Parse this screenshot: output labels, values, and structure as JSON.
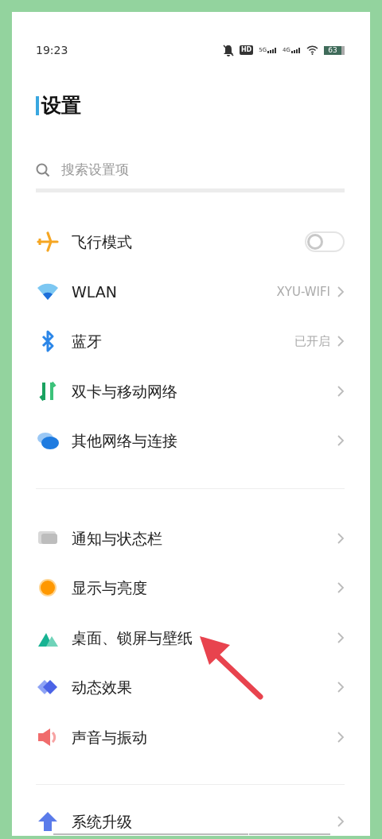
{
  "status_bar": {
    "time": "19:23",
    "hd_label": "HD",
    "networks": [
      "5G",
      "4G"
    ],
    "battery": "63"
  },
  "title": "设置",
  "search": {
    "placeholder": "搜索设置项"
  },
  "sections": [
    {
      "items": [
        {
          "kind": "toggle",
          "label": "飞行模式",
          "on": false
        },
        {
          "kind": "link",
          "label": "WLAN",
          "value": "XYU-WIFI"
        },
        {
          "kind": "link",
          "label": "蓝牙",
          "value": "已开启"
        },
        {
          "kind": "link",
          "label": "双卡与移动网络"
        },
        {
          "kind": "link",
          "label": "其他网络与连接"
        }
      ]
    },
    {
      "items": [
        {
          "kind": "link",
          "label": "通知与状态栏"
        },
        {
          "kind": "link",
          "label": "显示与亮度"
        },
        {
          "kind": "link",
          "label": "桌面、锁屏与壁纸"
        },
        {
          "kind": "link",
          "label": "动态效果"
        },
        {
          "kind": "link",
          "label": "声音与振动"
        }
      ]
    },
    {
      "items": [
        {
          "kind": "link",
          "label": "系统升级"
        }
      ]
    }
  ]
}
